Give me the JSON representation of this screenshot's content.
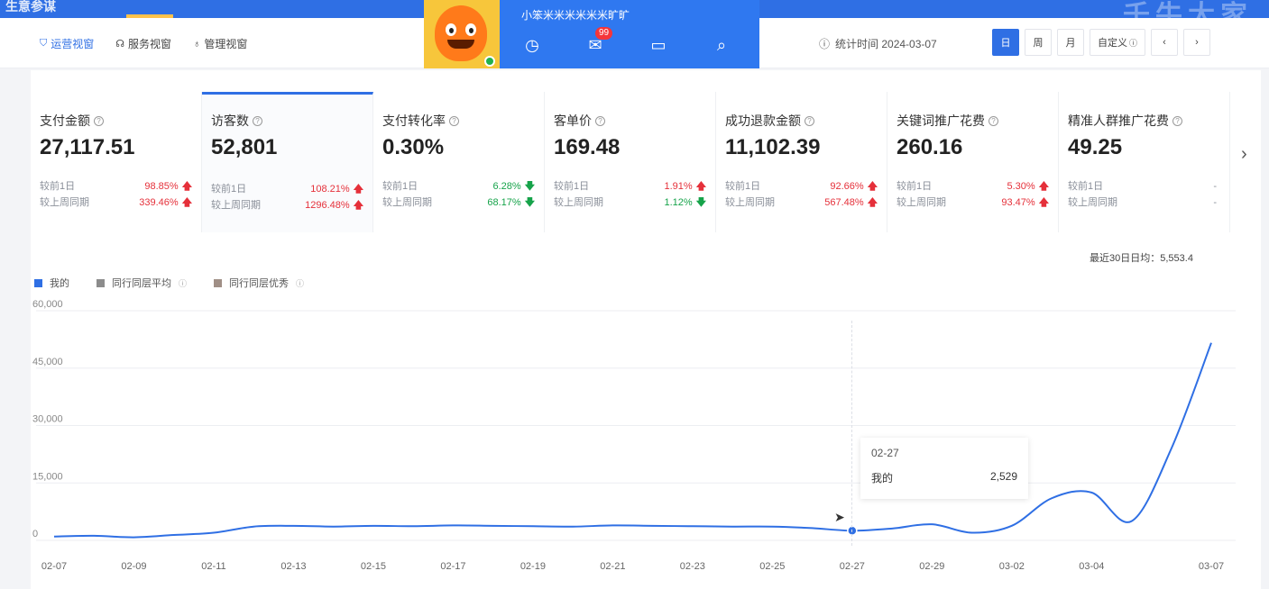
{
  "topbar": {
    "brand": "生意参谋",
    "watermark": "千牛大家"
  },
  "nav": {
    "tabs": [
      {
        "label": "运营视窗",
        "icon": "shield-icon"
      },
      {
        "label": "服务视窗",
        "icon": "headset-icon"
      },
      {
        "label": "管理视窗",
        "icon": "bulb-icon"
      }
    ],
    "stat_time_label": "统计时间 2024-03-07",
    "periods": [
      "日",
      "周",
      "月",
      "自定义"
    ],
    "active_period": "日"
  },
  "popup": {
    "username": "小笨米米米米米米旷旷",
    "icons": [
      "clock-icon",
      "mail-icon",
      "window-icon",
      "search-icon"
    ],
    "mail_badge": "99"
  },
  "metrics": [
    {
      "label": "支付金额",
      "value": "27,117.51",
      "day_label": "较前1日",
      "day_change": "98.85%",
      "day_dir": "up",
      "week_label": "较上周同期",
      "week_change": "339.46%",
      "week_dir": "up"
    },
    {
      "label": "访客数",
      "value": "52,801",
      "day_label": "较前1日",
      "day_change": "108.21%",
      "day_dir": "up",
      "week_label": "较上周同期",
      "week_change": "1296.48%",
      "week_dir": "up"
    },
    {
      "label": "支付转化率",
      "value": "0.30%",
      "day_label": "较前1日",
      "day_change": "6.28%",
      "day_dir": "down",
      "week_label": "较上周同期",
      "week_change": "68.17%",
      "week_dir": "down"
    },
    {
      "label": "客单价",
      "value": "169.48",
      "day_label": "较前1日",
      "day_change": "1.91%",
      "day_dir": "up",
      "week_label": "较上周同期",
      "week_change": "1.12%",
      "week_dir": "down"
    },
    {
      "label": "成功退款金额",
      "value": "11,102.39",
      "day_label": "较前1日",
      "day_change": "92.66%",
      "day_dir": "up",
      "week_label": "较上周同期",
      "week_change": "567.48%",
      "week_dir": "up"
    },
    {
      "label": "关键词推广花费",
      "value": "260.16",
      "day_label": "较前1日",
      "day_change": "5.30%",
      "day_dir": "up",
      "week_label": "较上周同期",
      "week_change": "93.47%",
      "week_dir": "up"
    },
    {
      "label": "精准人群推广花费",
      "value": "49.25",
      "day_label": "较前1日",
      "day_change": "-",
      "day_dir": "none",
      "week_label": "较上周同期",
      "week_change": "-",
      "week_dir": "none"
    }
  ],
  "avg_label": "最近30日日均：5,553.4",
  "legend": [
    {
      "name": "我的",
      "color": "#2f6fe4"
    },
    {
      "name": "同行同层平均",
      "color": "#8c8c8c"
    },
    {
      "name": "同行同层优秀",
      "color": "#a08f86"
    }
  ],
  "tooltip": {
    "date": "02-27",
    "label": "我的",
    "value": "2,529"
  },
  "chart_data": {
    "type": "line",
    "title": "",
    "xlabel": "",
    "ylabel": "",
    "ylim": [
      0,
      60000
    ],
    "yticks": [
      "0",
      "15,000",
      "30,000",
      "45,000",
      "60,000"
    ],
    "xticks": [
      "02-07",
      "02-09",
      "02-11",
      "02-13",
      "02-15",
      "02-17",
      "02-19",
      "02-21",
      "02-23",
      "02-25",
      "02-27",
      "02-29",
      "03-02",
      "03-04",
      "03-07"
    ],
    "grid": true,
    "legend_position": "top-left",
    "x": [
      "02-07",
      "02-08",
      "02-09",
      "02-10",
      "02-11",
      "02-12",
      "02-13",
      "02-14",
      "02-15",
      "02-16",
      "02-17",
      "02-18",
      "02-19",
      "02-20",
      "02-21",
      "02-22",
      "02-23",
      "02-24",
      "02-25",
      "02-26",
      "02-27",
      "02-28",
      "02-29",
      "03-01",
      "03-02",
      "03-03",
      "03-04",
      "03-05",
      "03-06",
      "03-07"
    ],
    "series": [
      {
        "name": "我的",
        "color": "#2f6fe4",
        "values": [
          1000,
          1200,
          800,
          1400,
          2000,
          3600,
          3800,
          3600,
          3800,
          3700,
          3900,
          3800,
          3700,
          3600,
          3900,
          3800,
          3700,
          3600,
          3600,
          3200,
          2529,
          3100,
          4200,
          2000,
          3800,
          11000,
          12500,
          5000,
          24000,
          51600
        ]
      }
    ]
  }
}
